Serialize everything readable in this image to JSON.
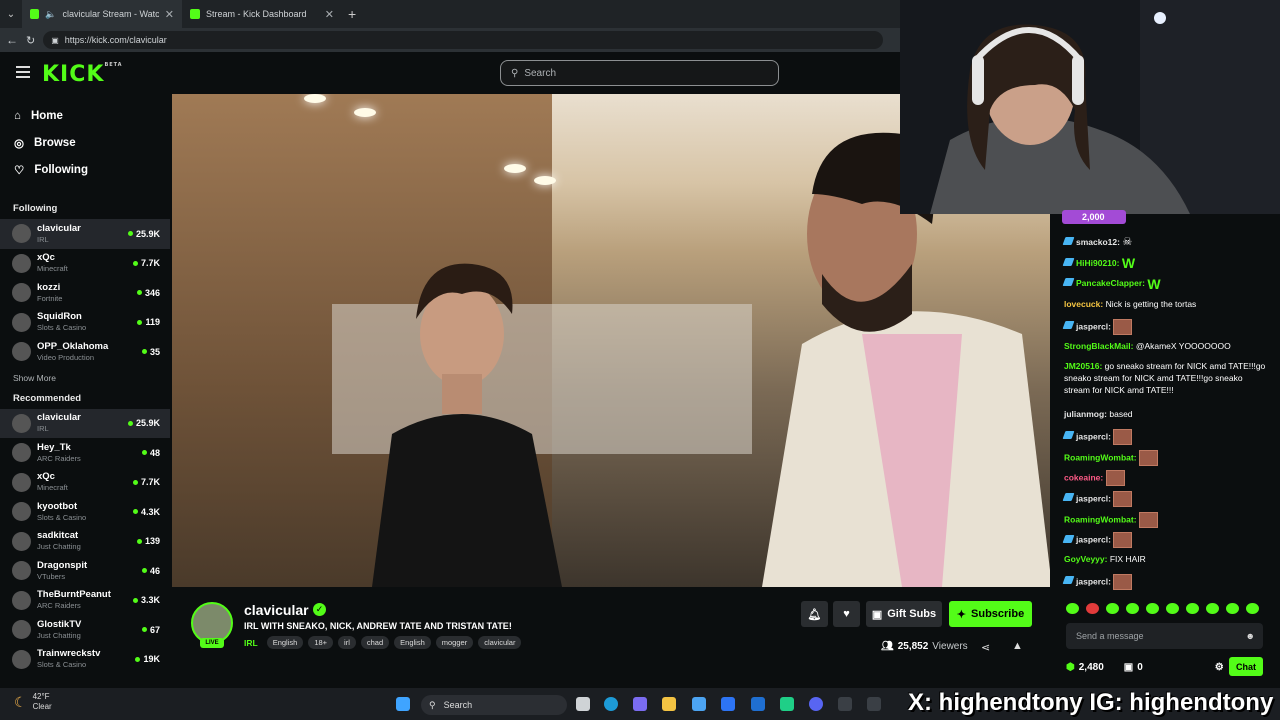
{
  "browser": {
    "tabs": [
      {
        "label": "clavicular Stream - Watch Live"
      },
      {
        "label": "Stream - Kick Dashboard"
      }
    ],
    "url": "https://kick.com/clavicular"
  },
  "kick": {
    "logo": "KICK",
    "logo_badge": "BETA",
    "search_placeholder": "Search",
    "nav": [
      {
        "label": "Home",
        "icon": "home-icon"
      },
      {
        "label": "Browse",
        "icon": "compass-icon"
      },
      {
        "label": "Following",
        "icon": "heart-icon"
      }
    ],
    "following_title": "Following",
    "following": [
      {
        "name": "clavicular",
        "category": "IRL",
        "viewers": "25.9K"
      },
      {
        "name": "xQc",
        "category": "Minecraft",
        "viewers": "7.7K"
      },
      {
        "name": "kozzi",
        "category": "Fortnite",
        "viewers": "346"
      },
      {
        "name": "SquidRon",
        "category": "Slots & Casino",
        "viewers": "119"
      },
      {
        "name": "OPP_Oklahoma",
        "category": "Video Production",
        "viewers": "35"
      }
    ],
    "show_more": "Show More",
    "recommended_title": "Recommended",
    "recommended": [
      {
        "name": "clavicular",
        "category": "IRL",
        "viewers": "25.9K"
      },
      {
        "name": "Hey_Tk",
        "category": "ARC Raiders",
        "viewers": "48"
      },
      {
        "name": "xQc",
        "category": "Minecraft",
        "viewers": "7.7K"
      },
      {
        "name": "kyootbot",
        "category": "Slots & Casino",
        "viewers": "4.3K"
      },
      {
        "name": "sadkitcat",
        "category": "Just Chatting",
        "viewers": "139"
      },
      {
        "name": "Dragonspit",
        "category": "VTubers",
        "viewers": "46"
      },
      {
        "name": "TheBurntPeanut",
        "category": "ARC Raiders",
        "viewers": "3.3K"
      },
      {
        "name": "GlostikTV",
        "category": "Just Chatting",
        "viewers": "67"
      },
      {
        "name": "Trainwreckstv",
        "category": "Slots & Casino",
        "viewers": "19K"
      }
    ],
    "channel": {
      "name": "clavicular",
      "live_label": "LIVE",
      "title": "IRL WITH SNEAKO, NICK, ANDREW TATE AND TRISTAN TATE!",
      "category": "IRL",
      "tags": [
        "English",
        "18+",
        "irl",
        "chad",
        "English",
        "mogger",
        "clavicular"
      ],
      "gift_label": "Gift Subs",
      "subscribe_label": "Subscribe",
      "viewers": "25,852",
      "viewers_label": "Viewers"
    },
    "chat": {
      "top_badge": "2,000",
      "messages": [
        {
          "user": "smacko12:",
          "text": "",
          "color": "#e6e6e6",
          "badge": true,
          "emote": "skull"
        },
        {
          "user": "HiHi90210:",
          "text": "",
          "color": "#53fc18",
          "badge": true,
          "emote": "W"
        },
        {
          "user": "PancakeClapper:",
          "text": "",
          "color": "#53fc18",
          "badge": true,
          "emote": "W"
        },
        {
          "user": "lovecuck:",
          "text": "Nick is getting the tortas",
          "color": "#f5c542",
          "badge": false,
          "emote": ""
        },
        {
          "user": "jaspercl:",
          "text": "",
          "color": "#e6e6e6",
          "badge": true,
          "emote": "img"
        },
        {
          "user": "StrongBlackMail:",
          "text": "@AkameX YOOOOOOO",
          "color": "#53fc18",
          "badge": false,
          "emote": ""
        },
        {
          "user": "JM20516:",
          "text": "go sneako stream for NICK amd TATE!!!go sneako stream for NICK amd TATE!!!go sneako stream for NICK amd TATE!!!",
          "color": "#53fc18",
          "badge": false,
          "emote": ""
        },
        {
          "user": "julianmog:",
          "text": "based",
          "color": "#e6e6e6",
          "badge": false,
          "emote": ""
        },
        {
          "user": "jaspercl:",
          "text": "",
          "color": "#e6e6e6",
          "badge": true,
          "emote": "img"
        },
        {
          "user": "RoamingWombat:",
          "text": "",
          "color": "#53fc18",
          "badge": false,
          "emote": "img"
        },
        {
          "user": "cokeaine:",
          "text": "",
          "color": "#ff5a87",
          "badge": false,
          "emote": "img"
        },
        {
          "user": "jaspercl:",
          "text": "",
          "color": "#e6e6e6",
          "badge": true,
          "emote": "img"
        },
        {
          "user": "RoamingWombat:",
          "text": "",
          "color": "#53fc18",
          "badge": false,
          "emote": "img"
        },
        {
          "user": "jaspercl:",
          "text": "",
          "color": "#e6e6e6",
          "badge": true,
          "emote": "img"
        },
        {
          "user": "GoyVeyyy:",
          "text": "FIX HAIR",
          "color": "#53fc18",
          "badge": false,
          "emote": ""
        },
        {
          "user": "jaspercl:",
          "text": "",
          "color": "#e6e6e6",
          "badge": true,
          "emote": "img"
        }
      ],
      "input_placeholder": "Send a message",
      "points": "2,480",
      "count": "0",
      "send_label": "Chat"
    }
  },
  "taskbar": {
    "temp": "42°F",
    "condition": "Clear",
    "search": "Search"
  },
  "overlay": "X: highendtony IG: highendtony",
  "colors": {
    "accent": "#53fc18",
    "bg": "#0b0e0f"
  }
}
